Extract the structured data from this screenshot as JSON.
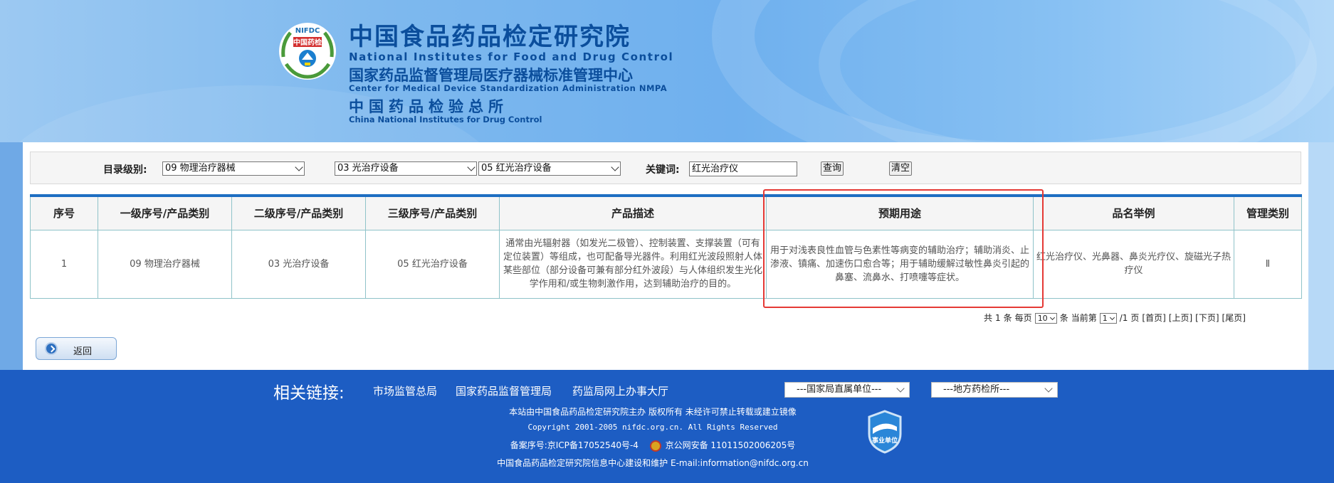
{
  "header": {
    "title_zh": "中国食品药品检定研究院",
    "title_en": "National Institutes for Food and Drug Control",
    "sub1_zh": "国家药品监督管理局医疗器械标准管理中心",
    "sub1_en": "Center for Medical Device Standardization Administration NMPA",
    "sub2_zh": "中国药品检验总所",
    "sub2_en": "China National Institutes for Drug Control",
    "logo_text": "NIFDC",
    "logo_inner": "中国药检"
  },
  "filter": {
    "catalog_label": "目录级别:",
    "level1_value": "09   物理治疗器械",
    "level2_value": "03   光治疗设备",
    "level3_value": "05   红光治疗设备",
    "keyword_label": "关键词:",
    "keyword_value": "红光治疗仪",
    "query_button": "查询",
    "clear_button": "清空"
  },
  "table": {
    "headers": [
      "序号",
      "一级序号/产品类别",
      "二级序号/产品类别",
      "三级序号/产品类别",
      "产品描述",
      "预期用途",
      "品名举例",
      "管理类别"
    ],
    "rows": [
      {
        "index": "1",
        "level1": "09 物理治疗器械",
        "level2": "03 光治疗设备",
        "level3": "05 红光治疗设备",
        "description": "通常由光辐射器（如发光二极管）、控制装置、支撑装置（可有定位装置）等组成，也可配备导光器件。利用红光波段照射人体某些部位（部分设备可兼有部分红外波段）与人体组织发生光化学作用和/或生物刺激作用，达到辅助治疗的目的。",
        "intended_use": "用于对浅表良性血管与色素性等病变的辅助治疗；辅助消炎、止渗液、镇痛、加速伤口愈合等；用于辅助缓解过敏性鼻炎引起的鼻塞、流鼻水、打喷嚏等症状。",
        "examples": "红光治疗仪、光鼻器、鼻炎光疗仪、旋磁光子热疗仪",
        "mgmt_class": "Ⅱ"
      }
    ]
  },
  "pagination": {
    "total_prefix": "共",
    "total": "1",
    "total_unit": "条",
    "per_page_label": "每页",
    "per_page": "10",
    "per_page_unit": "条",
    "current_label": "当前第",
    "current": "1",
    "pages": "/1",
    "page_unit": "页",
    "first": "[首页]",
    "prev": "[上页]",
    "next": "[下页]",
    "last": "[尾页]"
  },
  "back_button": "返回",
  "footer": {
    "links_label": "相关链接:",
    "links": [
      "市场监管总局",
      "国家药品监督管理局",
      "药监局网上办事大厅"
    ],
    "dropdown1": "---国家局直属单位---",
    "dropdown2": "---地方药检所---",
    "host_line": "本站由中国食品药品检定研究院主办 版权所有 未经许可禁止转载或建立镜像",
    "copyright": "Copyright 2001-2005 nifdc.org.cn. All Rights Reserved",
    "icp": "备案序号:京ICP备17052540号-4",
    "police": "京公网安备 11011502006205号",
    "maintain": "中国食品药品检定研究院信息中心建设和维护 E-mail:information@nifdc.org.cn",
    "badge_text": "事业单位"
  },
  "colors": {
    "brand_blue": "#0b4e9c",
    "footer_blue": "#1d5dc3",
    "table_accent": "#1e6ec2",
    "highlight_red": "#e53935"
  }
}
